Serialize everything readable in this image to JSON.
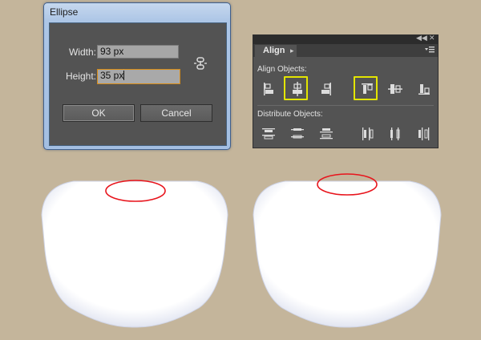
{
  "ellipse_dialog": {
    "title": "Ellipse",
    "width_label": "Width:",
    "width_value": "93 px",
    "height_label": "Height:",
    "height_value": "35 px",
    "constrain_icon": "link-icon",
    "ok_label": "OK",
    "cancel_label": "Cancel"
  },
  "align_panel": {
    "tab_label": "Align",
    "align_objects_label": "Align Objects:",
    "distribute_objects_label": "Distribute Objects:",
    "collapse_icon": "double-chevron-icon",
    "close_icon": "close-icon",
    "menu_icon": "panel-menu-icon",
    "highlight_color": "#e3e500",
    "align_buttons": [
      "horizontal-align-left",
      "horizontal-align-center",
      "horizontal-align-right",
      "vertical-align-top",
      "vertical-align-center",
      "vertical-align-bottom"
    ],
    "highlighted_buttons": [
      "horizontal-align-center",
      "vertical-align-top"
    ],
    "distribute_buttons": [
      "vertical-distribute-top",
      "vertical-distribute-center",
      "vertical-distribute-bottom",
      "horizontal-distribute-left",
      "horizontal-distribute-center",
      "horizontal-distribute-right"
    ]
  },
  "canvas": {
    "background_color": "#c4b59b",
    "shape_fill": "#ffffff",
    "shape_shadow": "#d8dcee",
    "ellipse_stroke": "#e8141c"
  }
}
